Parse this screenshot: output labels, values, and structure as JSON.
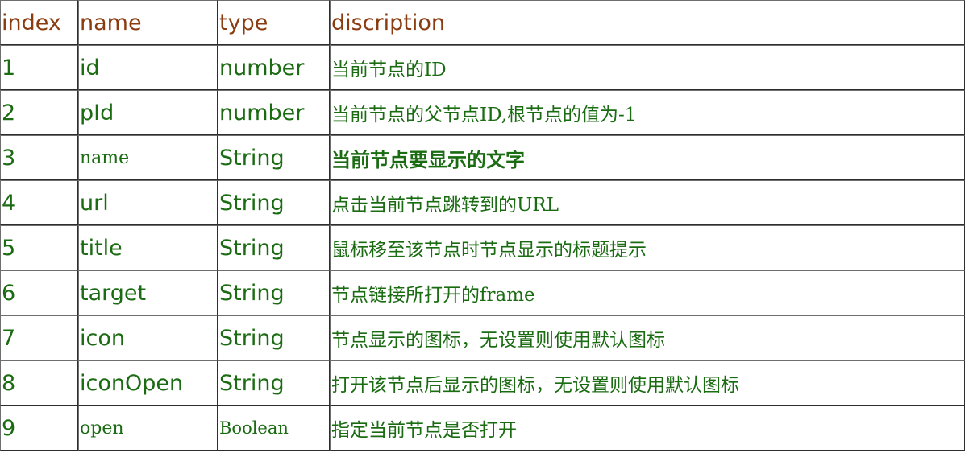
{
  "table": {
    "headers": {
      "index": "index",
      "name": "name",
      "type": "type",
      "description": "discription"
    },
    "rows": [
      {
        "index": "1",
        "name": "id",
        "type": "number",
        "description": "当前节点的ID"
      },
      {
        "index": "2",
        "name": "pId",
        "type": "number",
        "description": "当前节点的父节点ID,根节点的值为-1"
      },
      {
        "index": "3",
        "name": "name",
        "type": "String",
        "description": "当前节点要显示的文字"
      },
      {
        "index": "4",
        "name": "url",
        "type": "String",
        "description": "点击当前节点跳转到的URL"
      },
      {
        "index": "5",
        "name": "title",
        "type": "String",
        "description": "鼠标移至该节点时节点显示的标题提示"
      },
      {
        "index": "6",
        "name": "target",
        "type": "String",
        "description": "节点链接所打开的frame"
      },
      {
        "index": "7",
        "name": "icon",
        "type": "String",
        "description": "节点显示的图标，无设置则使用默认图标"
      },
      {
        "index": "8",
        "name": "iconOpen",
        "type": "String",
        "description": "打开该节点后显示的图标，无设置则使用默认图标"
      },
      {
        "index": "9",
        "name": "open",
        "type": "Boolean",
        "description": "指定当前节点是否打开"
      }
    ]
  },
  "colors": {
    "header_text": "#8a3b10",
    "body_text": "#1a6b12",
    "border": "#2e2e2e"
  }
}
